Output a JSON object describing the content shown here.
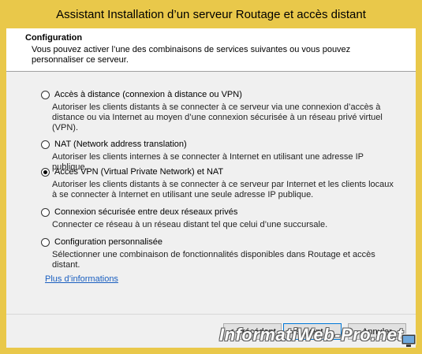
{
  "window": {
    "title": "Assistant Installation d’un serveur Routage et accès distant"
  },
  "header": {
    "title": "Configuration",
    "description": "Vous pouvez activer l’une des combinaisons de services suivantes ou vous pouvez personnaliser ce serveur."
  },
  "options": [
    {
      "label": "Accès à distance (connexion à distance ou VPN)",
      "description": "Autoriser les clients distants à se connecter à ce serveur via une connexion d’accès à distance ou via Internet au moyen d’une connexion sécurisée à un réseau privé virtuel (VPN).",
      "checked": false
    },
    {
      "label": "NAT (Network address translation)",
      "description": "Autoriser les clients internes à se connecter à Internet en utilisant une adresse IP publique.",
      "checked": false
    },
    {
      "label": "Accès VPN (Virtual Private Network) et NAT",
      "description": "Autoriser les clients distants à se connecter à ce serveur par Internet et les clients locaux à se connecter à Internet en utilisant une seule adresse IP publique.",
      "checked": true
    },
    {
      "label": "Connexion sécurisée entre deux réseaux privés",
      "description": "Connecter ce réseau à un réseau distant tel que celui d’une succursale.",
      "checked": false
    },
    {
      "label": "Configuration personnalisée",
      "description": "Sélectionner une combinaison de fonctionnalités disponibles dans Routage et accès distant.",
      "checked": false
    }
  ],
  "info_link": "Plus d’informations",
  "buttons": {
    "previous": "< Précédent",
    "next": "Suivant >",
    "cancel": "Annuler"
  },
  "watermark": "InformatiWeb-Pro.net",
  "colors": {
    "titlebar": "#e9c84a",
    "link": "#1a5fc0",
    "primary_border": "#0078d7"
  }
}
